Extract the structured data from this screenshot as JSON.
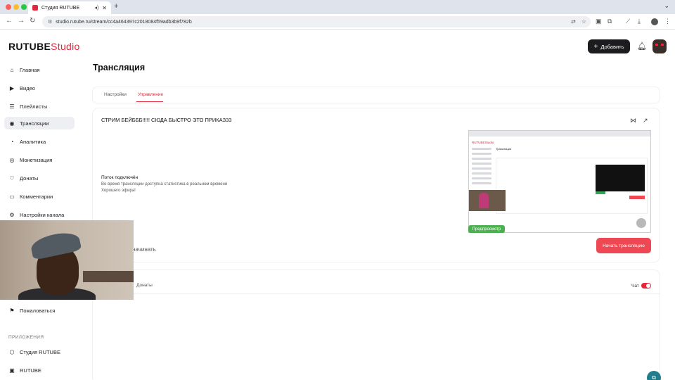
{
  "browser": {
    "tab_title": "Студия RUTUBE",
    "url": "studio.rutube.ru/stream/cc4a464397c2018084f59adb3b9f782b",
    "colors": {
      "traffic_red": "#ff5f57",
      "traffic_yellow": "#febc2e",
      "traffic_green": "#28c840"
    }
  },
  "header": {
    "logo_main": "RUTUBE",
    "logo_accent": "Studio",
    "add_button": "Добавить"
  },
  "sidebar": {
    "items": [
      {
        "label": "Главная",
        "icon": "home-icon"
      },
      {
        "label": "Видео",
        "icon": "video-icon"
      },
      {
        "label": "Плейлисты",
        "icon": "playlist-icon"
      },
      {
        "label": "Трансляции",
        "icon": "broadcast-icon"
      },
      {
        "label": "Аналитика",
        "icon": "analytics-icon"
      },
      {
        "label": "Монетизация",
        "icon": "coin-icon"
      },
      {
        "label": "Донаты",
        "icon": "donate-icon"
      },
      {
        "label": "Комментарии",
        "icon": "comment-icon"
      },
      {
        "label": "Настройки канала",
        "icon": "gear-icon"
      },
      {
        "label": "Пожаловаться",
        "icon": "flag-icon"
      }
    ],
    "apps_section": "ПРИЛОЖЕНИЯ",
    "apps": [
      {
        "label": "Студия RUTUBE",
        "icon": "studio-app-icon"
      },
      {
        "label": "RUTUBE",
        "icon": "rutube-app-icon"
      }
    ]
  },
  "main": {
    "page_title": "Трансляция",
    "tabs": [
      {
        "label": "Настройки"
      },
      {
        "label": "Управление"
      }
    ],
    "stream": {
      "title": "СТРИМ БЕЙБББ!!!!! СЮДА БЫСТРО ЭТО ПРИКАЗ33",
      "status_heading": "Поток подключён",
      "status_line1": "Во время трансляции доступна статистика в реальном времени",
      "status_line2": "Хорошего эфира!",
      "start_hint": "начинать",
      "start_button": "Начать трансляцию",
      "preview_badge": "Предпросмотр"
    },
    "bottom": {
      "donations_tab": "Донаты",
      "chat_label": "Чат",
      "chat_enabled": true
    }
  },
  "colors": {
    "accent": "#e4283b",
    "start_button": "#ee4854",
    "preview_badge": "#4cb050"
  }
}
